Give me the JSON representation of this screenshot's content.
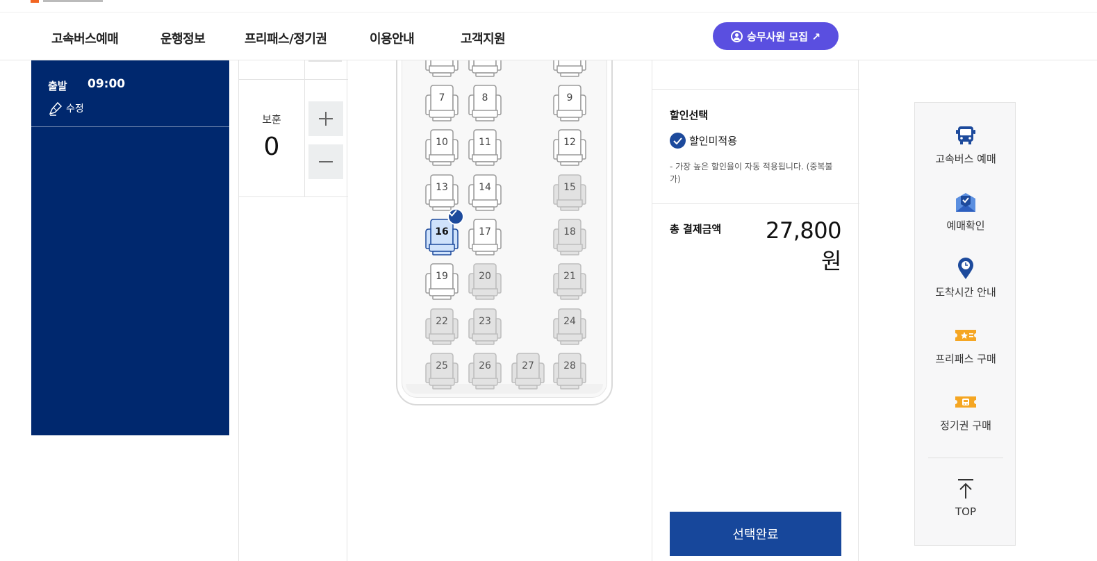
{
  "gnb": {
    "menus": [
      "고속버스예매",
      "운행정보",
      "프리패스/정기권",
      "이용안내",
      "고객지원"
    ],
    "recruit_button": "승무사원 모집 ↗"
  },
  "journey": {
    "depart_label": "출발",
    "depart_time": "09:00",
    "edit_label": "수정"
  },
  "passenger": {
    "type_label": "보훈",
    "count": "0",
    "plus_icon": "plus-icon",
    "minus_icon": "minus-icon"
  },
  "seats": [
    {
      "num": "7",
      "status": "available"
    },
    {
      "num": "8",
      "status": "available"
    },
    {
      "num": "9",
      "status": "available"
    },
    {
      "num": "10",
      "status": "available"
    },
    {
      "num": "11",
      "status": "available"
    },
    {
      "num": "12",
      "status": "available"
    },
    {
      "num": "13",
      "status": "available"
    },
    {
      "num": "14",
      "status": "available"
    },
    {
      "num": "15",
      "status": "sold"
    },
    {
      "num": "16",
      "status": "selected"
    },
    {
      "num": "17",
      "status": "available"
    },
    {
      "num": "18",
      "status": "sold"
    },
    {
      "num": "19",
      "status": "available"
    },
    {
      "num": "20",
      "status": "sold"
    },
    {
      "num": "21",
      "status": "sold"
    },
    {
      "num": "22",
      "status": "sold"
    },
    {
      "num": "23",
      "status": "sold"
    },
    {
      "num": "24",
      "status": "sold"
    },
    {
      "num": "25",
      "status": "sold"
    },
    {
      "num": "26",
      "status": "sold"
    },
    {
      "num": "27",
      "status": "sold"
    },
    {
      "num": "28",
      "status": "sold"
    }
  ],
  "discount": {
    "title": "할인선택",
    "option": "할인미적용",
    "note": "- 가장 높은 할인율이 자동 적용됩니다. (중복불가)"
  },
  "total": {
    "label": "총 결제금액",
    "amount": "27,800원"
  },
  "confirm_button": "선택완료",
  "quick_menu": {
    "items": [
      {
        "label": "고속버스 예매",
        "icon": "bus-icon"
      },
      {
        "label": "예매확인",
        "icon": "ticket-check-icon"
      },
      {
        "label": "도착시간 안내",
        "icon": "location-clock-icon"
      },
      {
        "label": "프리패스 구매",
        "icon": "freepass-ticket-icon"
      },
      {
        "label": "정기권 구매",
        "icon": "season-ticket-icon"
      }
    ],
    "top_label": "TOP"
  },
  "colors": {
    "navy_panel": "#00286e",
    "recruit_purple": "#5a4fe0",
    "primary_blue": "#17479b",
    "selected_seat": "#cfe2fb",
    "icon_orange": "#f5a623"
  }
}
